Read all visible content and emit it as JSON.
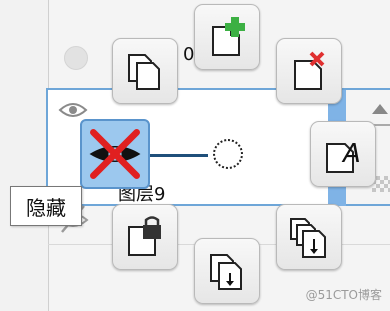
{
  "panel": {
    "row_top_value": "0",
    "layer_name": "图层9"
  },
  "tooltip": {
    "text": "隐藏"
  },
  "radial_menu": {
    "buttons": [
      {
        "name": "new-layer",
        "icon": "new-page-plus-icon"
      },
      {
        "name": "delete-layer",
        "icon": "page-delete-icon"
      },
      {
        "name": "duplicate-layer",
        "icon": "copy-pages-icon"
      },
      {
        "name": "rename-layer",
        "icon": "page-text-icon"
      },
      {
        "name": "lock-layer",
        "icon": "page-lock-icon"
      },
      {
        "name": "merge-down",
        "icon": "pages-merge-down-icon"
      },
      {
        "name": "move-down",
        "icon": "page-down-arrow-icon"
      }
    ]
  },
  "colors": {
    "selection_blue": "#6ea6d8",
    "thumb_blue": "#9cc8ee",
    "plus_green": "#3cb043",
    "delete_red": "#e03030"
  },
  "watermark": "@51CTO博客"
}
